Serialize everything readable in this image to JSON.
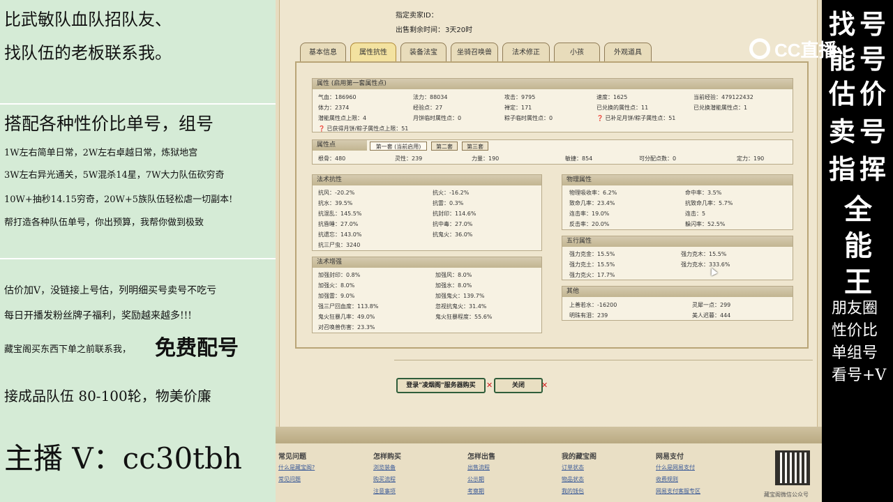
{
  "left_panel": {
    "lines": [
      "比武敏队血队招队友、",
      "找队伍的老板联系我。",
      "搭配各种性价比单号，组号",
      "1W左右简单日常，2W左右卓越日常，炼狱地宫",
      "3W左右异光通关，5W混杀14星，7W大力队伍砍穷奇",
      "10W+抽秒14.15穷奇，20W+5族队伍轻松虐一切副本!",
      "帮打造各种队伍单号，你出预算，我帮你做到极致",
      "估价加V，没链接上号估，列明细买号卖号不吃亏",
      "每日开播发粉丝牌子福利，奖励越来越多!!!",
      "藏宝阁买东西下单之前联系我，",
      "免费配号",
      "接成品队伍 80-100轮，物美价廉",
      "主播 V：cc30tbh"
    ]
  },
  "right_panel": {
    "logo": "CC直播",
    "big_chars": [
      "找",
      "号",
      "能",
      "号",
      "估",
      "价",
      "卖",
      "号",
      "指",
      "挥",
      "全",
      "能",
      "王"
    ],
    "small_lines": [
      "朋友圈",
      "性价比",
      "单组号",
      "看号+V"
    ]
  },
  "header": {
    "line1": "指定卖家ID：",
    "line2_label": "出售剩余时间：",
    "line2_value": "3天20时"
  },
  "tabs": [
    "基本信息",
    "属性抗性",
    "装备法宝",
    "坐骑召唤兽",
    "法术修正",
    "小孩",
    "外观道具"
  ],
  "attr_box": {
    "title": "属性 (启用第一套属性点)",
    "rows": [
      [
        "气血：186960",
        "法力：88034",
        "攻击：9795",
        "速度：1625",
        "当前经验：479122432"
      ],
      [
        "体力：2374",
        "经验点：27",
        "禅定：171",
        "已兑换的属性点：11",
        "已兑换潜能属性点：1"
      ],
      [
        "潜能属性点上限：4",
        "月饼临时属性点：0",
        "粽子临时属性点：0",
        "❓ 已补足月饼/粽子属性点：51",
        ""
      ],
      [
        "❓ 已获得月饼/粽子属性点上限：51",
        "",
        "",
        "",
        ""
      ]
    ]
  },
  "points_box": {
    "title": "属性点",
    "subtabs": [
      "第一套 (当前启用)",
      "第二套",
      "第三套"
    ],
    "values": [
      "根骨：480",
      "灵性：239",
      "力量：190",
      "敏捷：854",
      "可分配点数：0",
      "定力：190"
    ]
  },
  "resist_box": {
    "title": "法术抗性",
    "rows": [
      [
        "抗风：-20.2%",
        "抗火：-16.2%"
      ],
      [
        "抗水：39.5%",
        "抗雷：0.3%"
      ],
      [
        "抗混乱：145.5%",
        "抗封印：114.6%"
      ],
      [
        "抗昏睡：27.0%",
        "抗中毒：27.0%"
      ],
      [
        "抗遗忘：143.0%",
        "抗鬼火：36.0%"
      ],
      [
        "抗三尸虫：3240",
        ""
      ]
    ]
  },
  "boost_box": {
    "title": "法术增强",
    "rows": [
      [
        "加强封印：0.8%",
        "加强风：8.0%"
      ],
      [
        "加强火：8.0%",
        "加强水：8.0%"
      ],
      [
        "加强雷：9.0%",
        "加强鬼火：139.7%"
      ],
      [
        "强三尸回血度：113.8%",
        "忽视抗鬼火：31.4%"
      ],
      [
        "鬼火狂暴几率：49.0%",
        "鬼火狂暴程度：55.6%"
      ],
      [
        "对召唤兽伤害：23.3%",
        ""
      ]
    ]
  },
  "phys_box": {
    "title": "物理属性",
    "rows": [
      [
        "物理吸收率：6.2%",
        "命中率：3.5%"
      ],
      [
        "致命几率：23.4%",
        "抗致命几率：5.7%"
      ],
      [
        "连击率：19.0%",
        "连击：5"
      ],
      [
        "反击率：20.0%",
        "躲闪率：52.5%"
      ]
    ]
  },
  "wuxing_box": {
    "title": "五行属性",
    "rows": [
      [
        "强力克金：15.5%",
        "强力克木：15.5%"
      ],
      [
        "强力克土：15.5%",
        "强力克水：333.6%"
      ],
      [
        "强力克火：17.7%",
        ""
      ]
    ]
  },
  "other_box": {
    "title": "其他",
    "rows": [
      [
        "上善若水：-16200",
        "灵犀一点：299"
      ],
      [
        "明珠有泪：239",
        "美人迟暮：444"
      ]
    ]
  },
  "buttons": {
    "buy": "登录\"凌烟阁\"服务器购买",
    "close": "关闭"
  },
  "footer": {
    "columns": [
      {
        "head": "常见问题",
        "links": [
          "什么是藏宝阁?",
          "常见问题"
        ]
      },
      {
        "head": "怎样购买",
        "links": [
          "浏览装备",
          "购买流程",
          "注意事项"
        ]
      },
      {
        "head": "怎样出售",
        "links": [
          "出售流程",
          "公示期",
          "考察期"
        ]
      },
      {
        "head": "我的藏宝阁",
        "links": [
          "订单状态",
          "物品状态",
          "我的钱包"
        ]
      },
      {
        "head": "网易支付",
        "links": [
          "什么是网易支付",
          "收费规则",
          "网易支付客服专区"
        ]
      }
    ],
    "qr_caption": "藏宝阁微信公众号"
  }
}
